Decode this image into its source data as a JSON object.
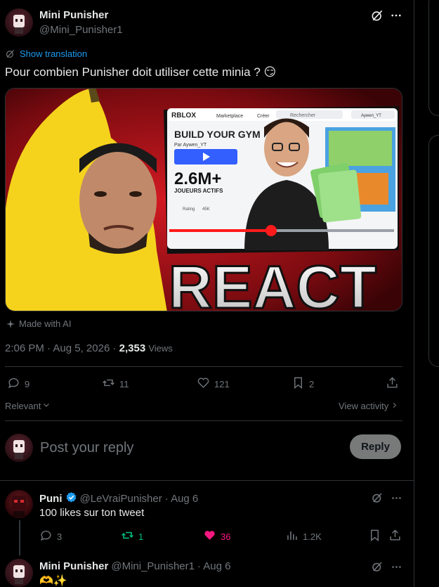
{
  "post": {
    "author_name": "Mini Punisher",
    "author_handle": "@Mini_Punisher1",
    "show_translation": "Show translation",
    "text": "Pour combien Punisher doit utiliser cette minia ? 😏",
    "made_with_ai": "Made with AI",
    "time": "2:06 PM",
    "date": "Aug 5, 2026",
    "views_count": "2,353",
    "views_label": "Views",
    "replies": "9",
    "reposts": "11",
    "likes": "121",
    "bookmarks": "2"
  },
  "thumbnail": {
    "brand": "RBLOX",
    "nav_marketplace": "Marketplace",
    "nav_creer": "Créer",
    "search_placeholder": "Rechercher",
    "account_name": "Aywen_YT",
    "game_title": "BUILD YOUR GYM",
    "game_by": "Par Aywen_YT",
    "stat_big": "2.6M+",
    "stat_sub": "JOUEURS ACTIFS",
    "rating_label": "Rating",
    "likes_small": "45K",
    "big_word": "REACT"
  },
  "filters": {
    "sort_label": "Relevant",
    "view_activity": "View activity"
  },
  "reply_box": {
    "placeholder": "Post your reply",
    "button": "Reply"
  },
  "replies": [
    {
      "name": "Puni",
      "handle": "@LeVraiPunisher",
      "date": "· Aug 6",
      "text": "100 likes sur ton tweet",
      "replies": "3",
      "reposts": "1",
      "likes": "36",
      "views": "1.2K"
    },
    {
      "name": "Mini Punisher",
      "handle": "@Mini_Punisher1",
      "date": "· Aug 6",
      "text": "🫶✨"
    }
  ],
  "colors": {
    "background": "#000000",
    "text": "#e7e9ea",
    "muted": "#71767b",
    "link": "#1d9bf0",
    "repost_active": "#00ba7c",
    "like_active": "#f91880",
    "thumb_red": "#c4121a",
    "thumb_yellow": "#f5d31c"
  },
  "icons": [
    "grok-icon",
    "more-icon",
    "translate-icon",
    "sparkle-icon",
    "reply-icon",
    "repost-icon",
    "like-icon",
    "bookmark-icon",
    "share-icon",
    "views-icon",
    "verified-icon",
    "chevron-down-icon",
    "chevron-right-icon"
  ]
}
